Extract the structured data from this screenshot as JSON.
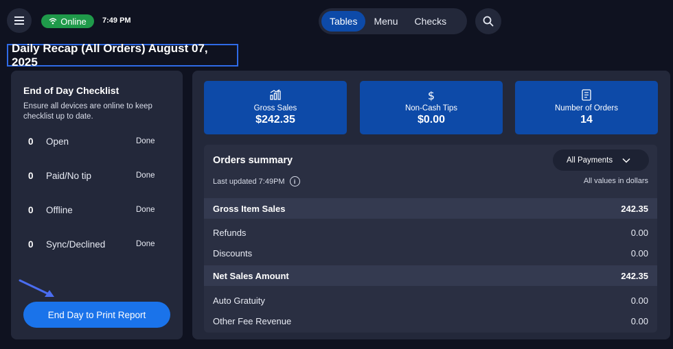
{
  "header": {
    "status": "Online",
    "time": "7:49 PM",
    "tabs": [
      {
        "label": "Tables",
        "active": true
      },
      {
        "label": "Menu",
        "active": false
      },
      {
        "label": "Checks",
        "active": false
      }
    ]
  },
  "page_title": "Daily Recap (All Orders) August 07, 2025",
  "checklist": {
    "title": "End of Day Checklist",
    "description": "Ensure all devices are online to keep checklist up to date.",
    "items": [
      {
        "count": "0",
        "label": "Open",
        "status": "Done"
      },
      {
        "count": "0",
        "label": "Paid/No tip",
        "status": "Done"
      },
      {
        "count": "0",
        "label": "Offline",
        "status": "Done"
      },
      {
        "count": "0",
        "label": "Sync/Declined",
        "status": "Done"
      }
    ],
    "button_label": "End Day to Print Report"
  },
  "stats": [
    {
      "label": "Gross Sales",
      "value": "$242.35",
      "icon": "chart-icon"
    },
    {
      "label": "Non-Cash Tips",
      "value": "$0.00",
      "icon": "dollar-icon"
    },
    {
      "label": "Number of Orders",
      "value": "14",
      "icon": "receipt-icon"
    }
  ],
  "summary": {
    "title": "Orders summary",
    "last_updated": "Last updated 7:49PM",
    "filter": "All Payments",
    "note": "All values in dollars",
    "rows": [
      {
        "label": "Gross Item Sales",
        "value": "242.35",
        "highlight": true
      },
      {
        "label": "Refunds",
        "value": "0.00",
        "highlight": false
      },
      {
        "label": "Discounts",
        "value": "0.00",
        "highlight": false
      },
      {
        "label": "Net Sales Amount",
        "value": "242.35",
        "highlight": true
      },
      {
        "label": "Auto Gratuity",
        "value": "0.00",
        "highlight": false
      },
      {
        "label": "Other Fee Revenue",
        "value": "0.00",
        "highlight": false
      }
    ]
  },
  "colors": {
    "background": "#0f1220",
    "panel": "#23283a",
    "accent_blue": "#0d4aa8",
    "button_blue": "#1a73ea",
    "online_green": "#1f9a4a",
    "title_box": "#2f6be8"
  }
}
